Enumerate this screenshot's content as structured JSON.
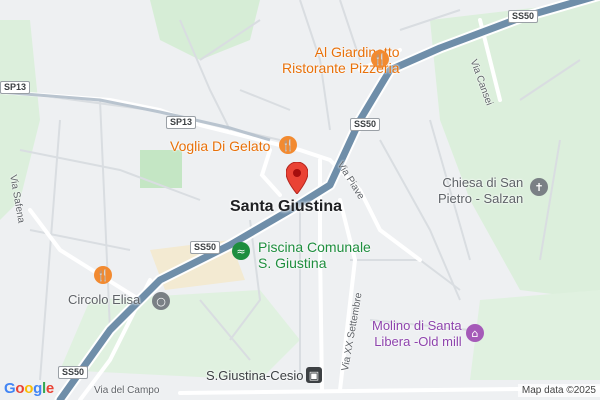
{
  "colors": {
    "highway": "#6f8ea9",
    "highway_edge": "#ffffff",
    "road": "#ffffff",
    "minor_road": "#d9dde1",
    "park": "#cfeccf",
    "urban": "#eef0f2",
    "sandy": "#f3ead2",
    "pin_red": "#ea4335"
  },
  "map": {
    "town_label": "Santa Giustina",
    "pois": [
      {
        "name": "Al Giardinetto Ristorante Pizzeria",
        "line1": "Al Giardinetto",
        "line2": "Ristorante Pizzeria",
        "icon": "restaurant-icon"
      },
      {
        "name": "Voglia Di Gelato",
        "line1": "Voglia Di Gelato",
        "icon": "restaurant-icon"
      },
      {
        "name": "Chiesa di San Pietro - Salzan",
        "line1": "Chiesa di San",
        "line2": "Pietro - Salzan",
        "icon": "church-icon"
      },
      {
        "name": "Piscina Comunale S. Giustina",
        "line1": "Piscina Comunale",
        "line2": "S. Giustina",
        "icon": "pool-icon"
      },
      {
        "name": "Circolo Elisa",
        "line1": "Circolo Elisa",
        "icon": "restaurant-icon"
      },
      {
        "name": "Molino di Santa Libera -Old mill",
        "line1": "Molino di Santa",
        "line2": "Libera -Old mill",
        "icon": "museum-icon"
      },
      {
        "name": "S.Giustina-Cesio",
        "line1": "S.Giustina-Cesio",
        "icon": "train-station-icon"
      }
    ],
    "road_shields": [
      "SS50",
      "SP13",
      "SP13",
      "SS50",
      "SS50",
      "SS50"
    ],
    "street_labels": [
      "Via Cansei",
      "Via Piave",
      "Via Safena",
      "Via XX Settembre",
      "Via del Campo"
    ]
  },
  "footer": {
    "logo_letters": [
      "G",
      "o",
      "o",
      "g",
      "l",
      "e"
    ],
    "logo_colors": [
      "#4285f4",
      "#ea4335",
      "#fbbc05",
      "#4285f4",
      "#34a853",
      "#ea4335"
    ],
    "credit": "Map data ©2025"
  }
}
